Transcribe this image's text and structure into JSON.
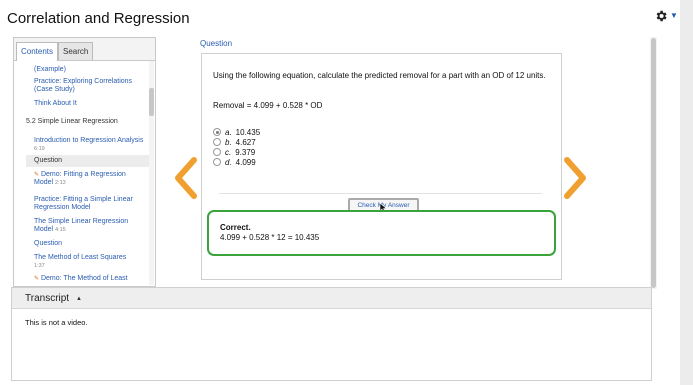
{
  "header": {
    "title": "Correlation and Regression"
  },
  "sidebar": {
    "tabs": [
      {
        "label": "Contents"
      },
      {
        "label": "Search"
      }
    ],
    "items": [
      {
        "label": "(Example)"
      },
      {
        "label": "Practice: Exploring Correlations (Case Study)"
      },
      {
        "label": "Think About It"
      },
      {
        "label": "5.2 Simple Linear Regression"
      },
      {
        "label": "Introduction to Regression Analysis",
        "duration": "6:19"
      },
      {
        "label": "Question"
      },
      {
        "label": "Demo: Fitting a Regression Model",
        "duration": "2:13"
      },
      {
        "label": "Practice: Fitting a Simple Linear Regression Model"
      },
      {
        "label": "The Simple Linear Regression Model",
        "duration": "4:15"
      },
      {
        "label": "Question"
      },
      {
        "label": "The Method of Least Squares",
        "duration": "1:37"
      },
      {
        "label": "Demo: The Method of Least"
      }
    ]
  },
  "question": {
    "label": "Question",
    "prompt": "Using the following equation, calculate the predicted removal for a part with an OD of 12 units.",
    "equation": "Removal = 4.099 + 0.528 * OD",
    "options": [
      {
        "letter": "a.",
        "value": "10.435",
        "selected": true
      },
      {
        "letter": "b.",
        "value": "4.627",
        "selected": false
      },
      {
        "letter": "c.",
        "value": "9.379",
        "selected": false
      },
      {
        "letter": "d.",
        "value": "4.099",
        "selected": false
      }
    ],
    "check_button": "Check My Answer",
    "feedback": {
      "title": "Correct.",
      "body": "4.099 + 0.528 * 12 = 10.435",
      "color": "#3aa33a"
    }
  },
  "transcript": {
    "title": "Transcript",
    "text": "This is not a video."
  },
  "colors": {
    "accent": "#2a5db0",
    "arrow": "#f0a030"
  }
}
